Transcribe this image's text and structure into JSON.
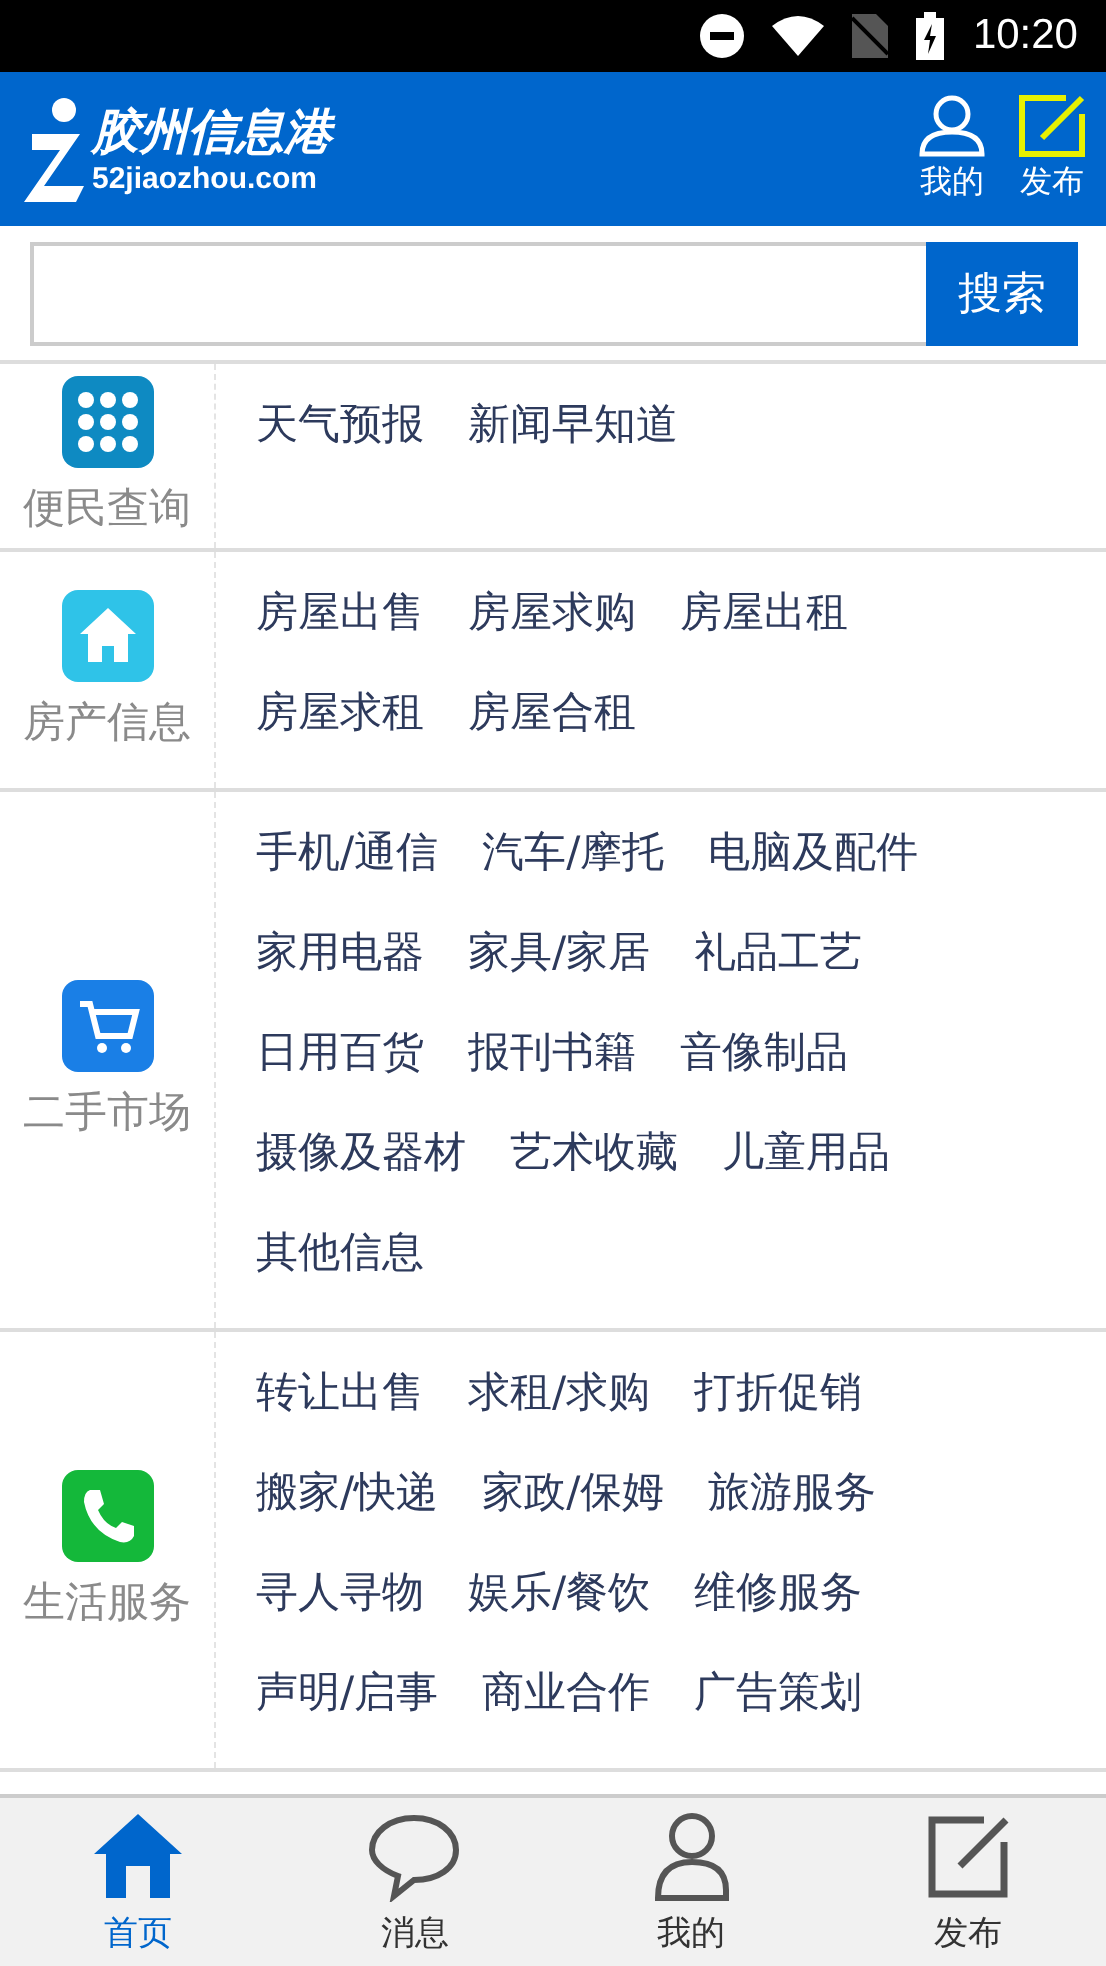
{
  "status_bar": {
    "time": "10:20"
  },
  "header": {
    "logo_title": "胶州信息港",
    "logo_domain": "52jiaozhou.com",
    "actions": [
      {
        "kind": "user",
        "label": "我的"
      },
      {
        "kind": "post",
        "label": "发布"
      }
    ]
  },
  "search": {
    "button": "搜索"
  },
  "sections": [
    {
      "kind": "grid",
      "title": "便民查询",
      "items": [
        "天气预报",
        "新闻早知道"
      ]
    },
    {
      "kind": "house",
      "title": "房产信息",
      "items": [
        "房屋出售",
        "房屋求购",
        "房屋出租",
        "房屋求租",
        "房屋合租"
      ]
    },
    {
      "kind": "cart",
      "title": "二手市场",
      "items": [
        "手机/通信",
        "汽车/摩托",
        "电脑及配件",
        "家用电器",
        "家具/家居",
        "礼品工艺",
        "日用百货",
        "报刊书籍",
        "音像制品",
        "摄像及器材",
        "艺术收藏",
        "儿童用品",
        "其他信息"
      ]
    },
    {
      "kind": "phone",
      "title": "生活服务",
      "items": [
        "转让出售",
        "求租/求购",
        "打折促销",
        "搬家/快递",
        "家政/保姆",
        "旅游服务",
        "寻人寻物",
        "娱乐/餐饮",
        "维修服务",
        "声明/启事",
        "商业合作",
        "广告策划"
      ]
    }
  ],
  "tab_bar": [
    {
      "kind": "home",
      "label": "首页",
      "selected": true
    },
    {
      "kind": "chat",
      "label": "消息",
      "selected": false
    },
    {
      "kind": "user",
      "label": "我的",
      "selected": false
    },
    {
      "kind": "post",
      "label": "发布",
      "selected": false
    }
  ]
}
